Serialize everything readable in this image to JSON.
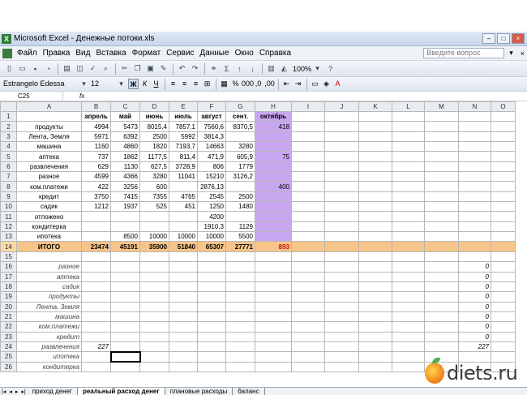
{
  "window": {
    "title": "Microsoft Excel - Денежные потоки.xls"
  },
  "menu": {
    "items": [
      "Файл",
      "Правка",
      "Вид",
      "Вставка",
      "Формат",
      "Сервис",
      "Данные",
      "Окно",
      "Справка"
    ],
    "ask_placeholder": "Введите вопрос"
  },
  "toolbar": {
    "zoom": "100%"
  },
  "format": {
    "font": "Estrangelo Edessa",
    "size": "12"
  },
  "formula": {
    "cell": "C25",
    "fx": "fx",
    "content": ""
  },
  "columns": [
    "A",
    "B",
    "C",
    "D",
    "E",
    "F",
    "G",
    "H",
    "I",
    "J",
    "K",
    "L",
    "M",
    "N",
    "O"
  ],
  "headers": {
    "B": "апрель",
    "C": "май",
    "D": "июнь",
    "E": "июль",
    "F": "август",
    "G": "сент.",
    "H": "октябрь"
  },
  "rows": [
    {
      "n": "1",
      "A": "",
      "B": "апрель",
      "C": "май",
      "D": "июнь",
      "E": "июль",
      "F": "август",
      "G": "сент.",
      "H": "октябрь"
    },
    {
      "n": "2",
      "A": "продукты",
      "B": "4994",
      "C": "5473",
      "D": "8015,4",
      "E": "7857,1",
      "F": "7560,6",
      "G": "8370,5",
      "H": "418"
    },
    {
      "n": "3",
      "A": "Лента, Земля",
      "B": "5971",
      "C": "6392",
      "D": "2500",
      "E": "5992",
      "F": "3814,3",
      "G": "",
      "H": ""
    },
    {
      "n": "4",
      "A": "машина",
      "B": "1160",
      "C": "4860",
      "D": "1820",
      "E": "7193,7",
      "F": "14663",
      "G": "3280",
      "H": ""
    },
    {
      "n": "5",
      "A": "аптека",
      "B": "737",
      "C": "1862",
      "D": "1177,5",
      "E": "811,4",
      "F": "471,9",
      "G": "605,9",
      "H": "75"
    },
    {
      "n": "6",
      "A": "развлечения",
      "B": "629",
      "C": "1130",
      "D": "627,5",
      "E": "3728,9",
      "F": "806",
      "G": "1779",
      "H": ""
    },
    {
      "n": "7",
      "A": "разное",
      "B": "4599",
      "C": "4366",
      "D": "3280",
      "E": "11041",
      "F": "15210",
      "G": "3126,2",
      "H": ""
    },
    {
      "n": "8",
      "A": "ком.платежи",
      "B": "422",
      "C": "3256",
      "D": "600",
      "E": "",
      "F": "2876,13",
      "G": "",
      "H": "400"
    },
    {
      "n": "9",
      "A": "кредит",
      "B": "3750",
      "C": "7415",
      "D": "7355",
      "E": "4765",
      "F": "2545",
      "G": "2500",
      "H": ""
    },
    {
      "n": "10",
      "A": "садик",
      "B": "1212",
      "C": "1937",
      "D": "525",
      "E": "451",
      "F": "1250",
      "G": "1480",
      "H": ""
    },
    {
      "n": "11",
      "A": "отложено",
      "B": "",
      "C": "",
      "D": "",
      "E": "",
      "F": "4200",
      "G": "",
      "H": ""
    },
    {
      "n": "12",
      "A": "кондитерка",
      "B": "",
      "C": "",
      "D": "",
      "E": "",
      "F": "1910,3",
      "G": "1129",
      "H": ""
    },
    {
      "n": "13",
      "A": "ипотека",
      "B": "",
      "C": "8500",
      "D": "10000",
      "E": "10000",
      "F": "10000",
      "G": "5500",
      "H": ""
    },
    {
      "n": "14",
      "A": "ИТОГО",
      "B": "23474",
      "C": "45191",
      "D": "35900",
      "E": "51840",
      "F": "65307",
      "G": "27771",
      "H": "893"
    }
  ],
  "lower_rows": [
    {
      "n": "15",
      "A": "",
      "B": "",
      "N": ""
    },
    {
      "n": "16",
      "A": "разное",
      "B": "",
      "N": "0"
    },
    {
      "n": "17",
      "A": "аптека",
      "B": "",
      "N": "0"
    },
    {
      "n": "18",
      "A": "садик",
      "B": "",
      "N": "0"
    },
    {
      "n": "19",
      "A": "продукты",
      "B": "",
      "N": "0"
    },
    {
      "n": "20",
      "A": "Лента, Земля",
      "B": "",
      "N": "0"
    },
    {
      "n": "21",
      "A": "машина",
      "B": "",
      "N": "0"
    },
    {
      "n": "22",
      "A": "ком.платежи",
      "B": "",
      "N": "0"
    },
    {
      "n": "23",
      "A": "кредит",
      "B": "",
      "N": "0"
    },
    {
      "n": "24",
      "A": "развлечения",
      "B": "227",
      "N": "227"
    },
    {
      "n": "25",
      "A": "ипотека",
      "B": "",
      "N": ""
    },
    {
      "n": "26",
      "A": "кондитерка",
      "B": "",
      "N": ""
    }
  ],
  "tabs": [
    "приход денег",
    "реальный расход денег",
    "плановые расходы",
    "баланс"
  ],
  "active_tab": "реальный расход денег",
  "watermark": "diets.ru",
  "colors": {
    "selected_column": "#f9d9a6",
    "highlight_purple": "#c8a6f0",
    "total_row": "#f7c489",
    "total_red": "#d01010"
  }
}
